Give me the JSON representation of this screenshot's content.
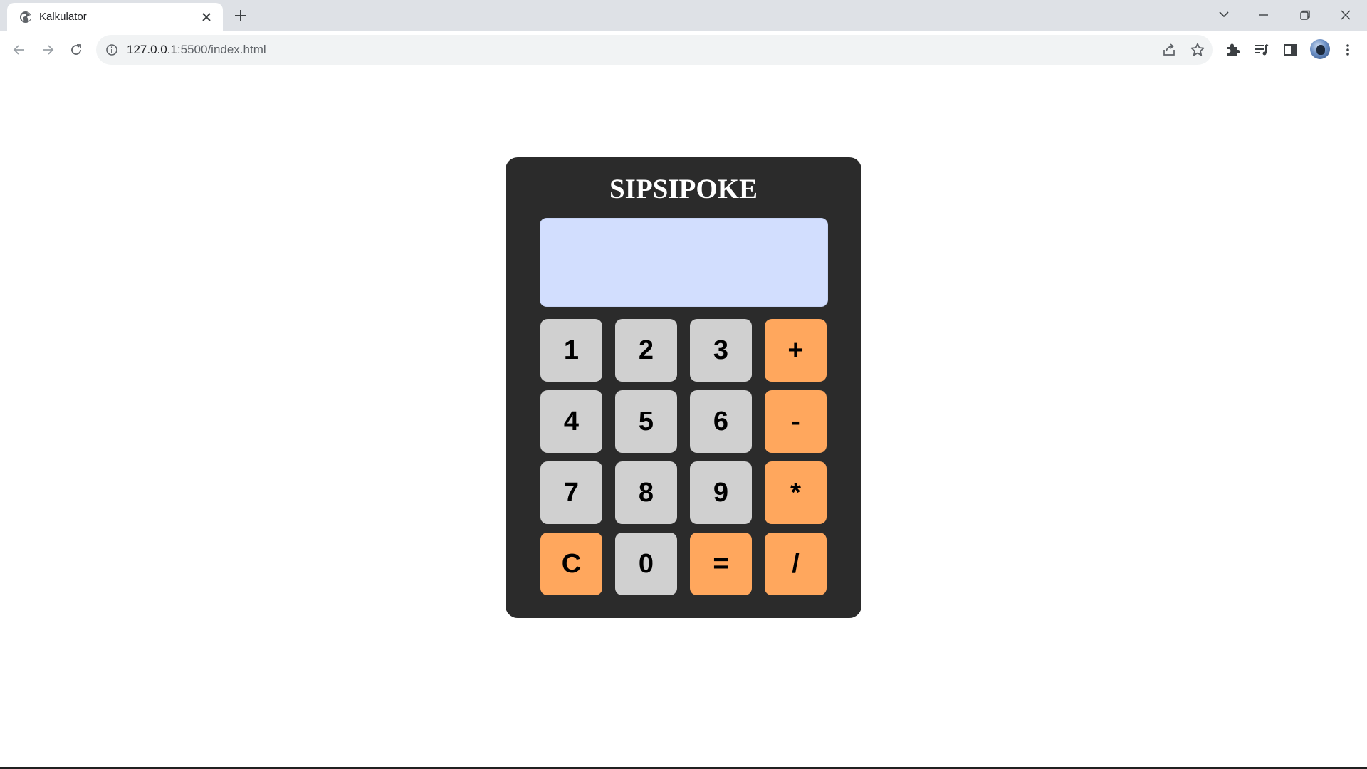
{
  "browser": {
    "tab_title": "Kalkulator",
    "url_host": "127.0.0.1",
    "url_rest": ":5500/index.html",
    "icons": {
      "favicon": "globe-icon",
      "tab_close": "close-icon",
      "new_tab": "plus-icon",
      "tab_search": "chevron-down-icon",
      "minimize": "minimize-icon",
      "restore": "restore-icon",
      "close_window": "close-icon",
      "back": "arrow-left-icon",
      "forward": "arrow-right-icon",
      "reload": "reload-icon",
      "site_info": "info-icon",
      "share": "share-icon",
      "bookmark": "star-icon",
      "extensions": "puzzle-icon",
      "reading_list": "reading-list-icon",
      "side_panel": "side-panel-icon",
      "profile": "avatar",
      "menu": "kebab-menu-icon"
    }
  },
  "calculator": {
    "title": "SIPSIPOKE",
    "display_value": "",
    "colors": {
      "body": "#2b2b2b",
      "display": "#d2defe",
      "number_key": "#d0d0d0",
      "operator_key": "#ffa75d",
      "title_text": "#ffffff"
    },
    "keys": [
      {
        "label": "1",
        "kind": "num"
      },
      {
        "label": "2",
        "kind": "num"
      },
      {
        "label": "3",
        "kind": "num"
      },
      {
        "label": "+",
        "kind": "op"
      },
      {
        "label": "4",
        "kind": "num"
      },
      {
        "label": "5",
        "kind": "num"
      },
      {
        "label": "6",
        "kind": "num"
      },
      {
        "label": "-",
        "kind": "op"
      },
      {
        "label": "7",
        "kind": "num"
      },
      {
        "label": "8",
        "kind": "num"
      },
      {
        "label": "9",
        "kind": "num"
      },
      {
        "label": "*",
        "kind": "op"
      },
      {
        "label": "C",
        "kind": "op"
      },
      {
        "label": "0",
        "kind": "num"
      },
      {
        "label": "=",
        "kind": "op"
      },
      {
        "label": "/",
        "kind": "op"
      }
    ]
  }
}
